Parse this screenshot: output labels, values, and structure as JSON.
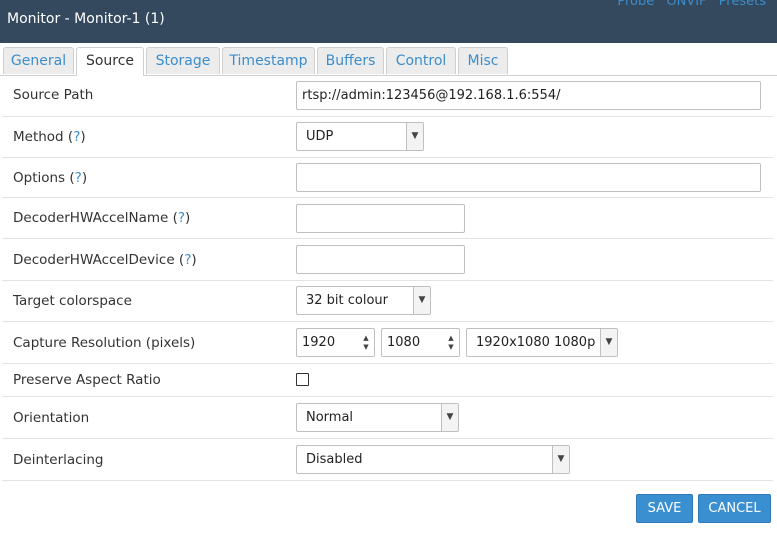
{
  "header": {
    "title": "Monitor - Monitor-1 (1)",
    "links": [
      "Probe",
      "ONVIF",
      "Presets"
    ]
  },
  "tabs": [
    "General",
    "Source",
    "Storage",
    "Timestamp",
    "Buffers",
    "Control",
    "Misc"
  ],
  "active_tab": "Source",
  "form": {
    "source_path": {
      "label": "Source Path",
      "value": "rtsp://admin:123456@192.168.1.6:554/"
    },
    "method": {
      "label": "Method",
      "help": "?",
      "value": "UDP"
    },
    "options": {
      "label": "Options",
      "help": "?",
      "value": ""
    },
    "decoder_name": {
      "label": "DecoderHWAccelName",
      "help": "?",
      "value": ""
    },
    "decoder_device": {
      "label": "DecoderHWAccelDevice",
      "help": "?",
      "value": ""
    },
    "colorspace": {
      "label": "Target colorspace",
      "value": "32 bit colour"
    },
    "resolution": {
      "label": "Capture Resolution (pixels)",
      "width": "1920",
      "height": "1080",
      "preset": "1920x1080 1080p"
    },
    "aspect": {
      "label": "Preserve Aspect Ratio",
      "checked": false
    },
    "orientation": {
      "label": "Orientation",
      "value": "Normal"
    },
    "deinterlacing": {
      "label": "Deinterlacing",
      "value": "Disabled"
    }
  },
  "buttons": {
    "save": "SAVE",
    "cancel": "CANCEL"
  },
  "colors": {
    "header_bg": "#34495e",
    "accent": "#3c8dcb",
    "button_bg": "#3a8fd0"
  }
}
